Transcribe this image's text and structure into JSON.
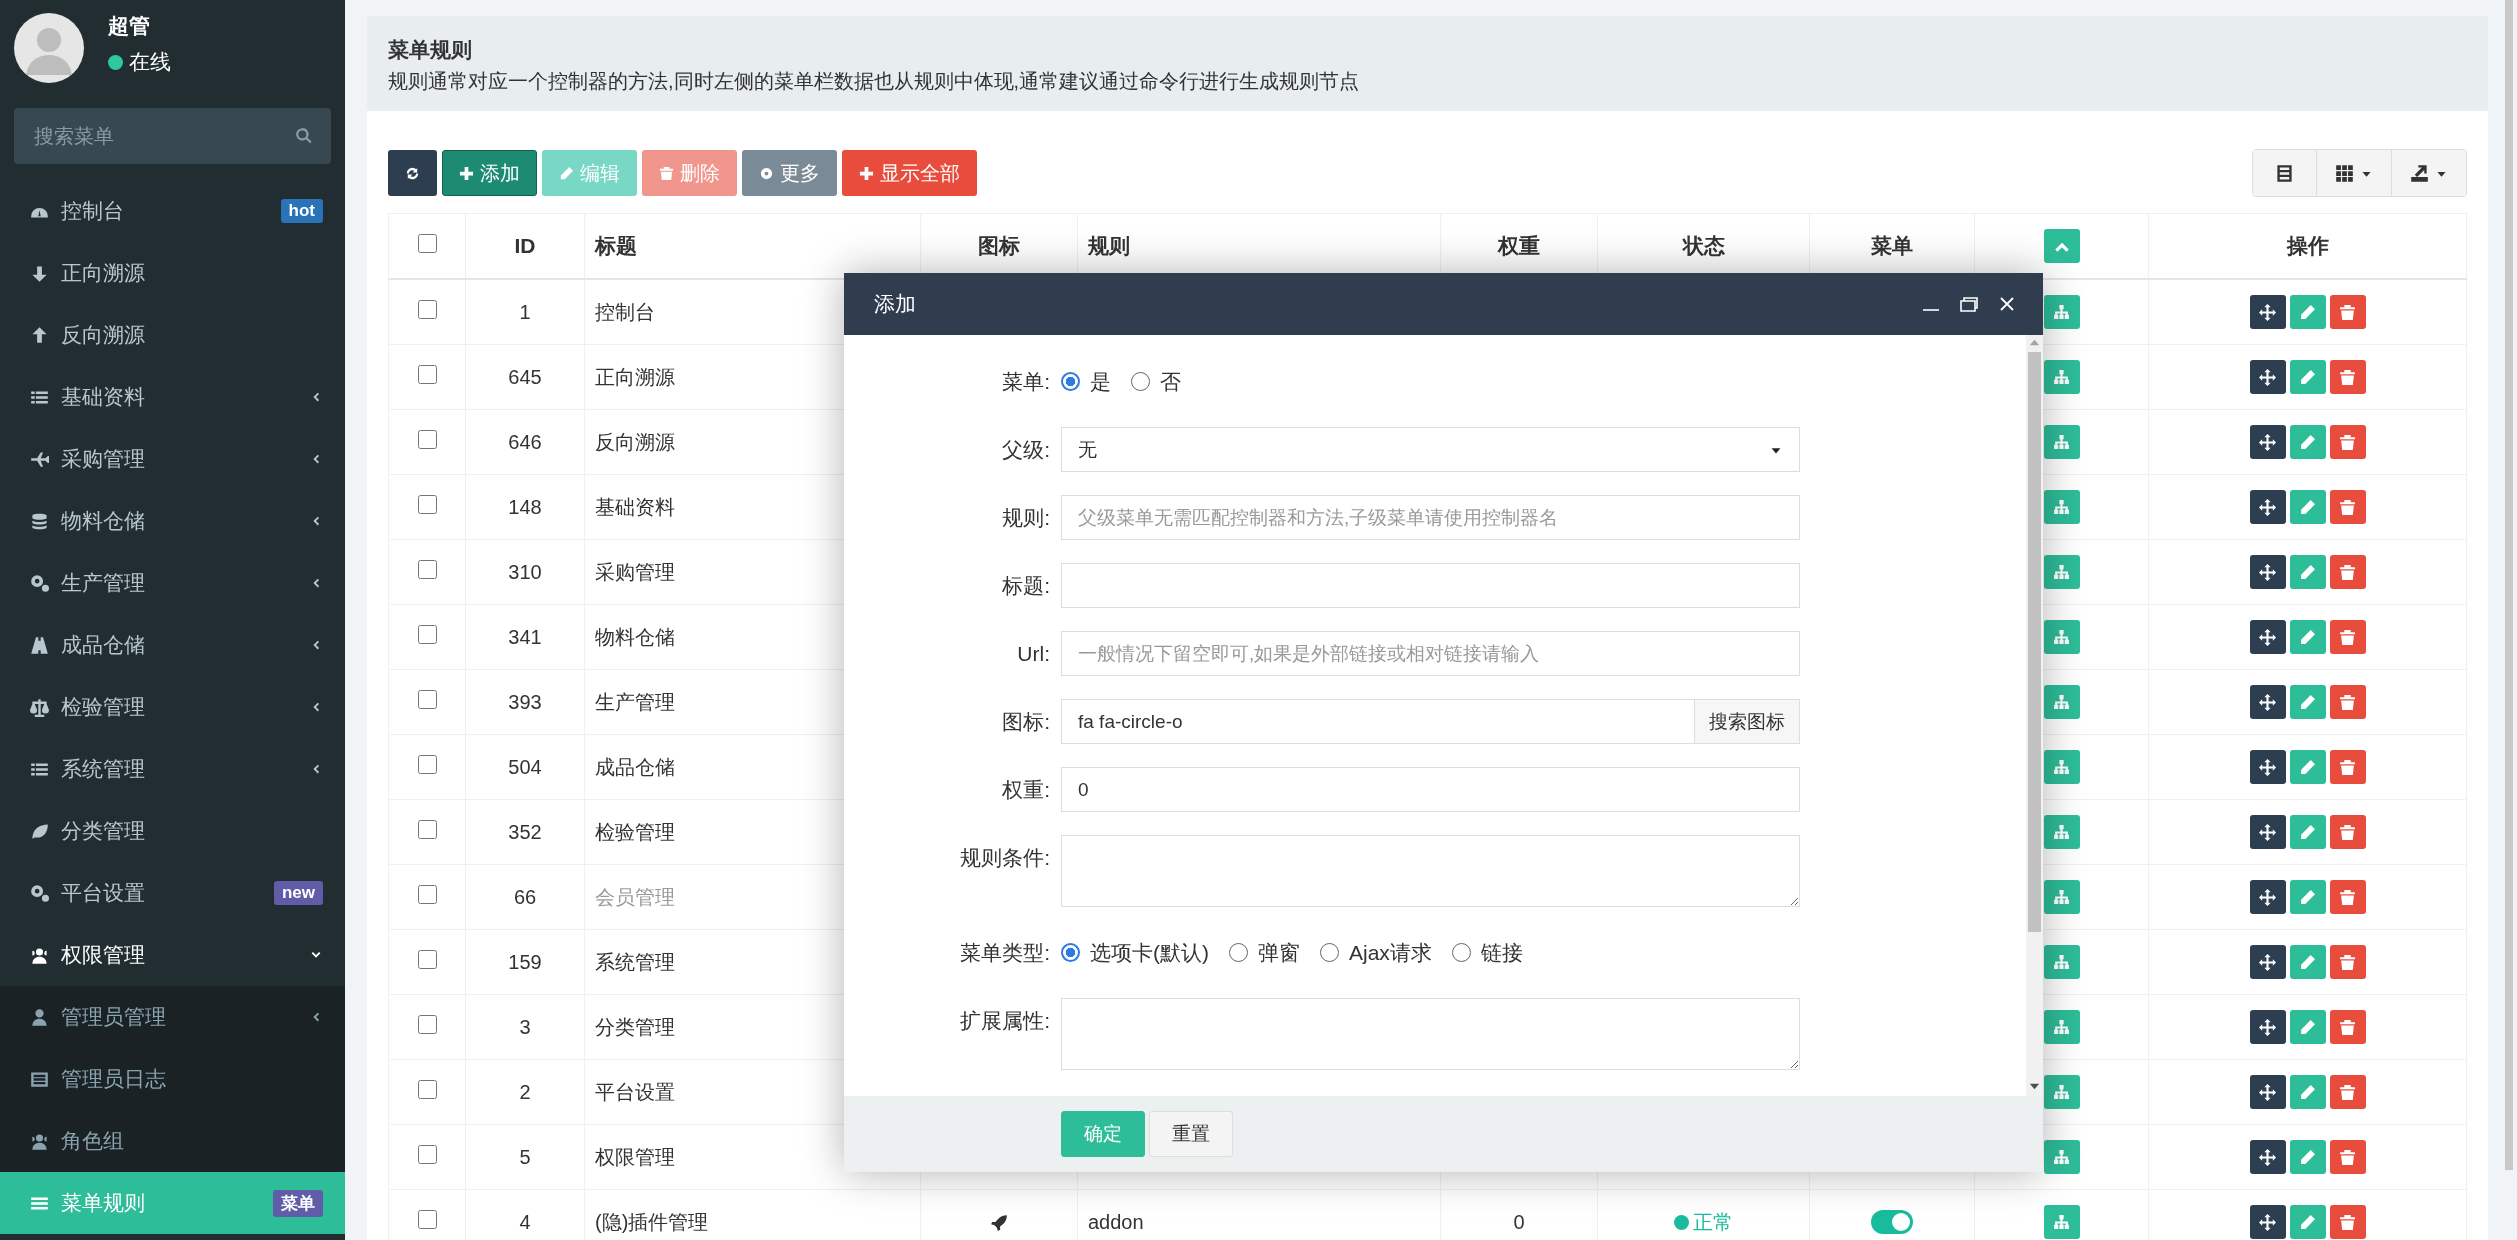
{
  "sidebar": {
    "user": {
      "name": "超管",
      "status": "在线",
      "online": true
    },
    "search": {
      "placeholder": "搜索菜单"
    },
    "items": [
      {
        "label": "控制台",
        "selected": false,
        "badge": {
          "text": "hot",
          "color": "#2a73b8"
        }
      },
      {
        "label": "正向溯源",
        "selected": false
      },
      {
        "label": "反向溯源",
        "selected": false
      },
      {
        "label": "基础资料",
        "selected": false,
        "expanded": false
      },
      {
        "label": "采购管理",
        "selected": false,
        "expanded": false
      },
      {
        "label": "物料仓储",
        "selected": false,
        "expanded": false
      },
      {
        "label": "生产管理",
        "selected": false,
        "expanded": false
      },
      {
        "label": "成品仓储",
        "selected": false,
        "expanded": false
      },
      {
        "label": "检验管理",
        "selected": false,
        "expanded": false
      },
      {
        "label": "系统管理",
        "selected": false,
        "expanded": false
      },
      {
        "label": "分类管理",
        "selected": false
      },
      {
        "label": "平台设置",
        "selected": false,
        "badge": {
          "text": "new",
          "color": "#605ca8"
        }
      },
      {
        "label": "权限管理",
        "selected": false,
        "expanded": true,
        "children": [
          {
            "label": "管理员管理",
            "selected": false,
            "expanded": false
          },
          {
            "label": "管理员日志",
            "selected": false
          },
          {
            "label": "角色组",
            "selected": false
          },
          {
            "label": "菜单规则",
            "selected": true,
            "badge": {
              "text": "菜单",
              "color": "#605ca8"
            }
          }
        ]
      }
    ]
  },
  "header": {
    "title": "菜单规则",
    "description": "规则通常对应一个控制器的方法,同时左侧的菜单栏数据也从规则中体现,通常建议通过命令行进行生成规则节点"
  },
  "toolbar": [
    {
      "kind": "refresh",
      "disabled": false
    },
    {
      "kind": "add",
      "label": "添加",
      "disabled": false
    },
    {
      "kind": "edit",
      "label": "编辑",
      "disabled": true
    },
    {
      "kind": "delete",
      "label": "删除",
      "disabled": true
    },
    {
      "kind": "more",
      "label": "更多",
      "disabled": false
    },
    {
      "kind": "showall",
      "label": "显示全部",
      "disabled": false
    }
  ],
  "table": {
    "columns": [
      {
        "kind": "checkbox",
        "checked": false
      },
      {
        "kind": "text",
        "label": "ID"
      },
      {
        "kind": "text",
        "label": "标题"
      },
      {
        "kind": "text",
        "label": "图标"
      },
      {
        "kind": "text",
        "label": "规则"
      },
      {
        "kind": "text",
        "label": "权重"
      },
      {
        "kind": "text",
        "label": "状态"
      },
      {
        "kind": "text",
        "label": "菜单"
      },
      {
        "kind": "toggle"
      },
      {
        "kind": "text",
        "label": "操作"
      }
    ],
    "rows": [
      {
        "checked": false,
        "id": "1",
        "title": "控制台",
        "disabled": false
      },
      {
        "checked": false,
        "id": "645",
        "title": "正向溯源",
        "disabled": false
      },
      {
        "checked": false,
        "id": "646",
        "title": "反向溯源",
        "disabled": false
      },
      {
        "checked": false,
        "id": "148",
        "title": "基础资料",
        "disabled": false
      },
      {
        "checked": false,
        "id": "310",
        "title": "采购管理",
        "disabled": false
      },
      {
        "checked": false,
        "id": "341",
        "title": "物料仓储",
        "disabled": false
      },
      {
        "checked": false,
        "id": "393",
        "title": "生产管理",
        "disabled": false
      },
      {
        "checked": false,
        "id": "504",
        "title": "成品仓储",
        "disabled": false
      },
      {
        "checked": false,
        "id": "352",
        "title": "检验管理",
        "disabled": false
      },
      {
        "checked": false,
        "id": "66",
        "title": "会员管理",
        "disabled": true
      },
      {
        "checked": false,
        "id": "159",
        "title": "系统管理",
        "disabled": false
      },
      {
        "checked": false,
        "id": "3",
        "title": "分类管理",
        "disabled": false
      },
      {
        "checked": false,
        "id": "2",
        "title": "平台设置",
        "disabled": false
      },
      {
        "checked": false,
        "id": "5",
        "title": "权限管理",
        "disabled": false
      },
      {
        "checked": false,
        "id": "4",
        "title": "(隐)插件管理",
        "disabled": false,
        "rule": "addon",
        "weight": "0",
        "status": "正常",
        "menu_on": true
      }
    ]
  },
  "modal": {
    "title": "添加",
    "fields": [
      {
        "kind": "radio",
        "label": "菜单:",
        "options": [
          {
            "label": "是",
            "selected": true
          },
          {
            "label": "否",
            "selected": false
          }
        ]
      },
      {
        "kind": "select",
        "label": "父级:",
        "value": "无"
      },
      {
        "kind": "input",
        "label": "规则:",
        "placeholder": "父级菜单无需匹配控制器和方法,子级菜单请使用控制器名"
      },
      {
        "kind": "input",
        "label": "标题:"
      },
      {
        "kind": "input",
        "label": "Url:",
        "placeholder": "一般情况下留空即可,如果是外部链接或相对链接请输入"
      },
      {
        "kind": "addon",
        "label": "图标:",
        "value": "fa fa-circle-o",
        "button": "搜索图标"
      },
      {
        "kind": "input",
        "label": "权重:",
        "value": "0"
      },
      {
        "kind": "textarea",
        "label": "规则条件:"
      },
      {
        "kind": "radio",
        "label": "菜单类型:",
        "options": [
          {
            "label": "选项卡(默认)",
            "selected": true
          },
          {
            "label": "弹窗",
            "selected": false
          },
          {
            "label": "Ajax请求",
            "selected": false
          },
          {
            "label": "链接",
            "selected": false
          }
        ]
      },
      {
        "kind": "textarea",
        "label": "扩展属性:"
      }
    ],
    "buttons": [
      {
        "kind": "primary",
        "label": "确定"
      },
      {
        "kind": "default",
        "label": "重置"
      }
    ]
  }
}
